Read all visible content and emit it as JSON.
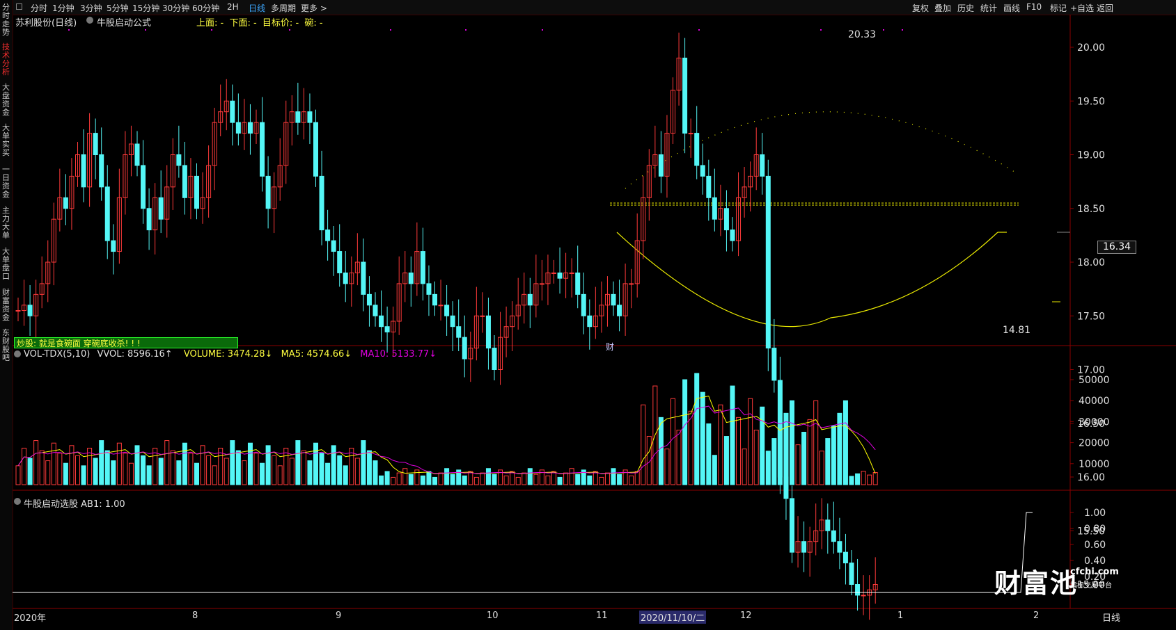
{
  "topbar": {
    "tabs": [
      "分时",
      "1分钟",
      "3分钟",
      "5分钟",
      "15分钟",
      "30分钟",
      "60分钟",
      "2H",
      "日线",
      "多周期",
      "更多 >"
    ],
    "active_tab": "日线",
    "right_tabs": [
      "复权",
      "叠加",
      "历史",
      "统计",
      "画线",
      "F10",
      "标记",
      "+自选",
      "返回"
    ]
  },
  "leftbar": {
    "items": [
      "分时走势",
      "技术分析",
      "大盘资金",
      "大单实买",
      "一日资金",
      "主力大单",
      "大单盘口",
      "财富资金",
      "东财股吧"
    ],
    "active_item": "技术分析"
  },
  "main": {
    "stock_title": "苏利股份(日线)",
    "formula_name": "牛股启动公式",
    "formula_values": "上面: -  下面: -  目标价: -  碗: -",
    "price_labels": [
      "20.00",
      "19.50",
      "19.00",
      "18.50",
      "18.00",
      "17.50",
      "17.00",
      "16.50",
      "16.00",
      "15.50",
      "15.00"
    ],
    "price_ticks": [
      20.0,
      19.5,
      19.0,
      18.5,
      18.0,
      17.5,
      17.0,
      16.5,
      16.0,
      15.5,
      15.0
    ],
    "high_label": "20.33",
    "low_label": "14.81",
    "current_price": "16.34",
    "banner": "炒股: 就是食碗面 穿碗底收杀! ! !",
    "cai_marker": "财"
  },
  "volume": {
    "header_name": "VOL-TDX(5,10)",
    "vvol": "VVOL: 8596.16↑",
    "volume": "VOLUME: 3474.28↓",
    "ma5": "MA5: 4574.66↓",
    "ma10": "MA10: 5133.77↓",
    "axis_labels": [
      "50000",
      "40000",
      "30000",
      "20000",
      "10000"
    ],
    "axis_ticks": [
      50000,
      40000,
      30000,
      20000,
      10000
    ]
  },
  "signal": {
    "header": "牛股启动选股 AB1: 1.00",
    "axis_labels": [
      "1.00",
      "0.80",
      "0.60",
      "0.40",
      "0.20"
    ],
    "axis_ticks": [
      1.0,
      0.8,
      0.6,
      0.4,
      0.2
    ]
  },
  "timeaxis": {
    "labels": [
      "2020年",
      "8",
      "9",
      "10",
      "11",
      "2020/11/10/二",
      "12",
      "1",
      "2"
    ],
    "period_label": "日线"
  },
  "watermark": {
    "brand": "财富池",
    "domain": "cfchi.com",
    "sub": "指标交易平台"
  },
  "colors": {
    "up": "#ff3a3a",
    "down": "#54f6f6",
    "bg": "#000000",
    "ma5": "#ffff00",
    "ma10": "#e000e0",
    "title_blue": "#3da8ff",
    "yellow_text": "#ffff40"
  }
}
